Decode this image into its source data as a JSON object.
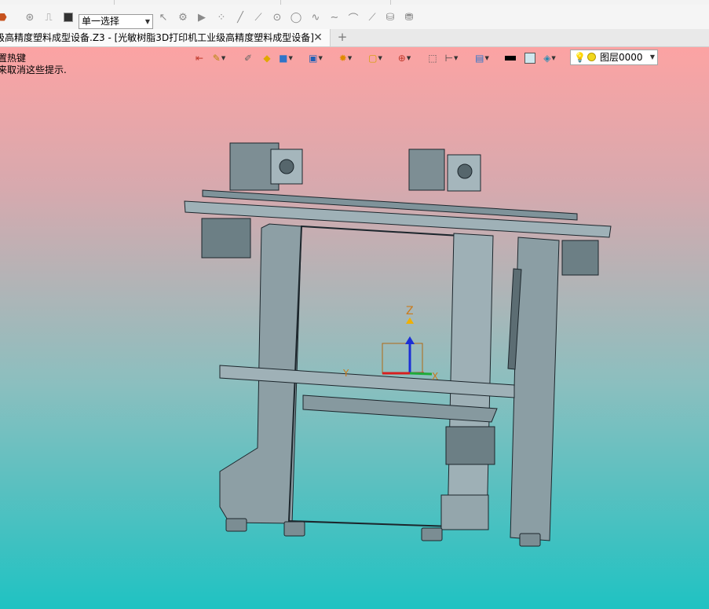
{
  "window": {
    "select_mode": "单一选择"
  },
  "tabs": [
    {
      "title": "级高精度塑料成型设备.Z3 - [光敏树脂3D打印机工业级高精度塑料成型设备]",
      "close": "✕"
    }
  ],
  "new_tab": "+",
  "viewport": {
    "hint_line1": "置热键",
    "hint_line2": "来取消这些提示.",
    "layer": "图层0000",
    "axis_z": "Z",
    "axis_y": "Y",
    "axis_x": "X",
    "background_top": "#fca3a3",
    "background_bottom": "#1fc2c2"
  },
  "toolbar_icons": [
    "app-logo-icon",
    "history-icon",
    "undo-pin-icon",
    "stop-icon",
    "select-filter-icon",
    "pick-icon",
    "play-icon",
    "points-icon",
    "line-icon",
    "line2-icon",
    "circle-point-icon",
    "circle-icon",
    "curve-icon",
    "wave-icon",
    "arc-icon",
    "line3-icon",
    "surface-icon",
    "surface2-icon"
  ],
  "view_toolbar_icons": [
    "exit-icon",
    "paint-icon",
    "pencil-icon",
    "solid-yellow-icon",
    "cube-blue-icon",
    "view-cube-icon",
    "render-icon",
    "frame-icon",
    "axis-target-icon",
    "fit-icon",
    "measure-icon",
    "screen-icon",
    "black-color-icon",
    "white-color-icon",
    "layer-stack-icon"
  ]
}
